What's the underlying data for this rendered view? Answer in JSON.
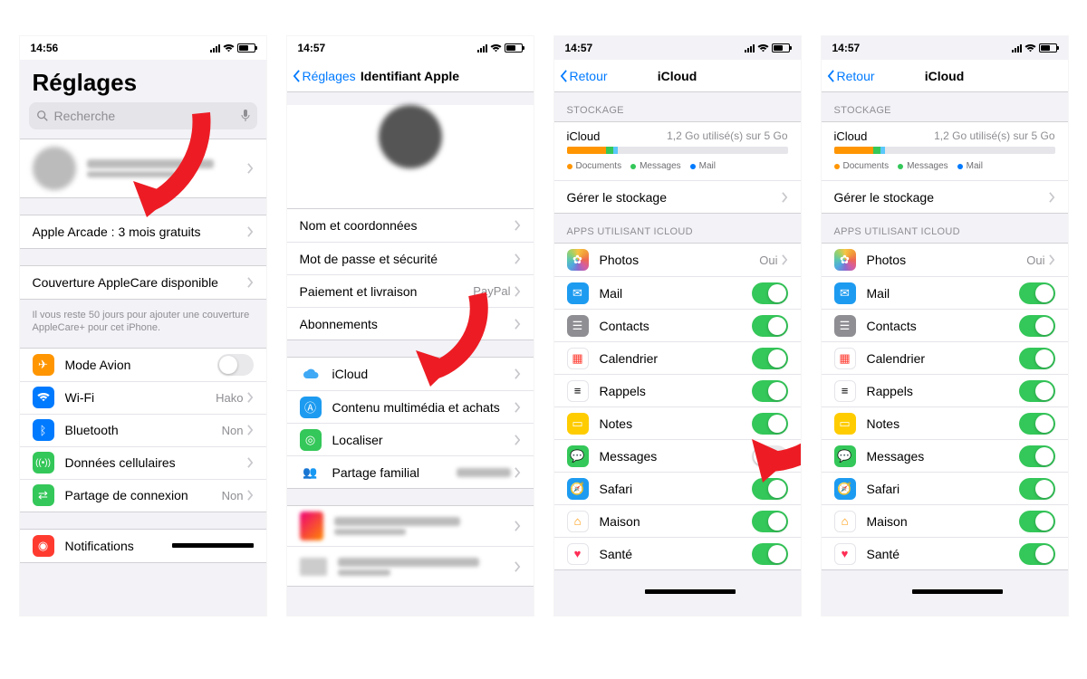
{
  "screens": {
    "s1": {
      "time": "14:56",
      "title": "Réglages",
      "search_placeholder": "Recherche",
      "promo": "Apple Arcade : 3 mois gratuits",
      "applecare_title": "Couverture AppleCare disponible",
      "applecare_note": "Il vous reste 50 jours pour ajouter une couverture AppleCare+ pour cet iPhone.",
      "rows": {
        "airplane": "Mode Avion",
        "wifi": "Wi-Fi",
        "wifi_val": "Hako",
        "bt": "Bluetooth",
        "bt_val": "Non",
        "cellular": "Données cellulaires",
        "hotspot": "Partage de connexion",
        "hotspot_val": "Non",
        "notifications": "Notifications"
      }
    },
    "s2": {
      "time": "14:57",
      "back": "Réglages",
      "title": "Identifiant Apple",
      "rows": {
        "name": "Nom et coordonnées",
        "password": "Mot de passe et sécurité",
        "payment": "Paiement et livraison",
        "payment_val": "PayPal",
        "subs": "Abonnements",
        "icloud": "iCloud",
        "media": "Contenu multimédia et achats",
        "findmy": "Localiser",
        "family": "Partage familial"
      }
    },
    "icloud": {
      "time": "14:57",
      "back": "Retour",
      "title": "iCloud",
      "storage_header": "Stockage",
      "storage_label": "iCloud",
      "storage_used": "1,2 Go utilisé(s) sur 5 Go",
      "legend": {
        "documents": "Documents",
        "messages": "Messages",
        "mail": "Mail"
      },
      "manage": "Gérer le stockage",
      "apps_header": "Apps utilisant iCloud",
      "apps": {
        "photos": "Photos",
        "photos_val": "Oui",
        "mail": "Mail",
        "contacts": "Contacts",
        "calendar": "Calendrier",
        "reminders": "Rappels",
        "notes": "Notes",
        "messages": "Messages",
        "safari": "Safari",
        "home": "Maison",
        "health": "Santé"
      }
    }
  },
  "colors": {
    "orange": "#ff9500",
    "blue": "#007aff",
    "green": "#34c759",
    "red": "#ff3b30",
    "grey": "#8e8e93",
    "teal": "#5ac8fa",
    "doc": "#ff9500",
    "msg": "#34c759",
    "mailc": "#007aff",
    "photos": "linear-gradient(135deg,#f09,#ff0,#0cf,#90f)"
  },
  "storage_segments": [
    {
      "w": 18,
      "c": "#ff9500"
    },
    {
      "w": 3,
      "c": "#34c759"
    },
    {
      "w": 2,
      "c": "#5ac8fa"
    }
  ],
  "s3_messages_on": false,
  "s4_messages_on": true
}
